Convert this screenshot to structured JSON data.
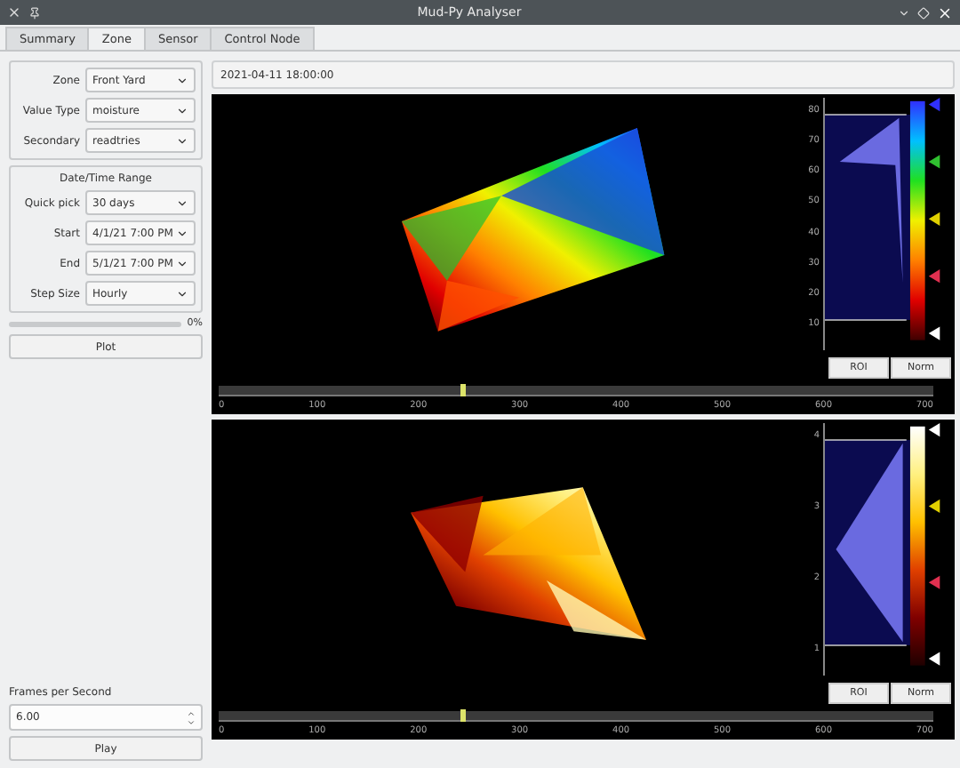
{
  "window": {
    "title": "Mud-Py Analyser"
  },
  "tabs": [
    {
      "label": "Summary",
      "selected": false
    },
    {
      "label": "Zone",
      "selected": true
    },
    {
      "label": "Sensor",
      "selected": false
    },
    {
      "label": "Control Node",
      "selected": false
    }
  ],
  "filters": [
    {
      "label": "Zone",
      "value": "Front Yard"
    },
    {
      "label": "Value Type",
      "value": "moisture"
    },
    {
      "label": "Secondary",
      "value": "readtries"
    }
  ],
  "date_range": {
    "title": "Date/Time Range",
    "fields": [
      {
        "label": "Quick pick",
        "value": "30 days"
      },
      {
        "label": "Start",
        "value": "4/1/21 7:00 PM"
      },
      {
        "label": "End",
        "value": "5/1/21 7:00 PM"
      },
      {
        "label": "Step Size",
        "value": "Hourly"
      }
    ]
  },
  "progress": {
    "level": 0,
    "reading": "0%"
  },
  "plot_button": "Plot",
  "fps": {
    "label": "Frames per Second",
    "value": "6.00"
  },
  "play_button": "Play",
  "timestamp": "2021-04-11 18:00:00",
  "views": [
    {
      "kind": "rainbow",
      "levels": [
        "80",
        "70",
        "60",
        "50",
        "40",
        "30",
        "20",
        "10"
      ],
      "buttons": [
        "ROI",
        "Norm"
      ],
      "timeline": {
        "level": 0.34,
        "ticks": [
          "0",
          "100",
          "200",
          "300",
          "400",
          "500",
          "600",
          "700"
        ]
      }
    },
    {
      "kind": "heat",
      "levels": [
        "4",
        "3",
        "2",
        "1"
      ],
      "buttons": [
        "ROI",
        "Norm"
      ],
      "timeline": {
        "level": 0.34,
        "ticks": [
          "0",
          "100",
          "200",
          "300",
          "400",
          "500",
          "600",
          "700"
        ]
      }
    }
  ]
}
